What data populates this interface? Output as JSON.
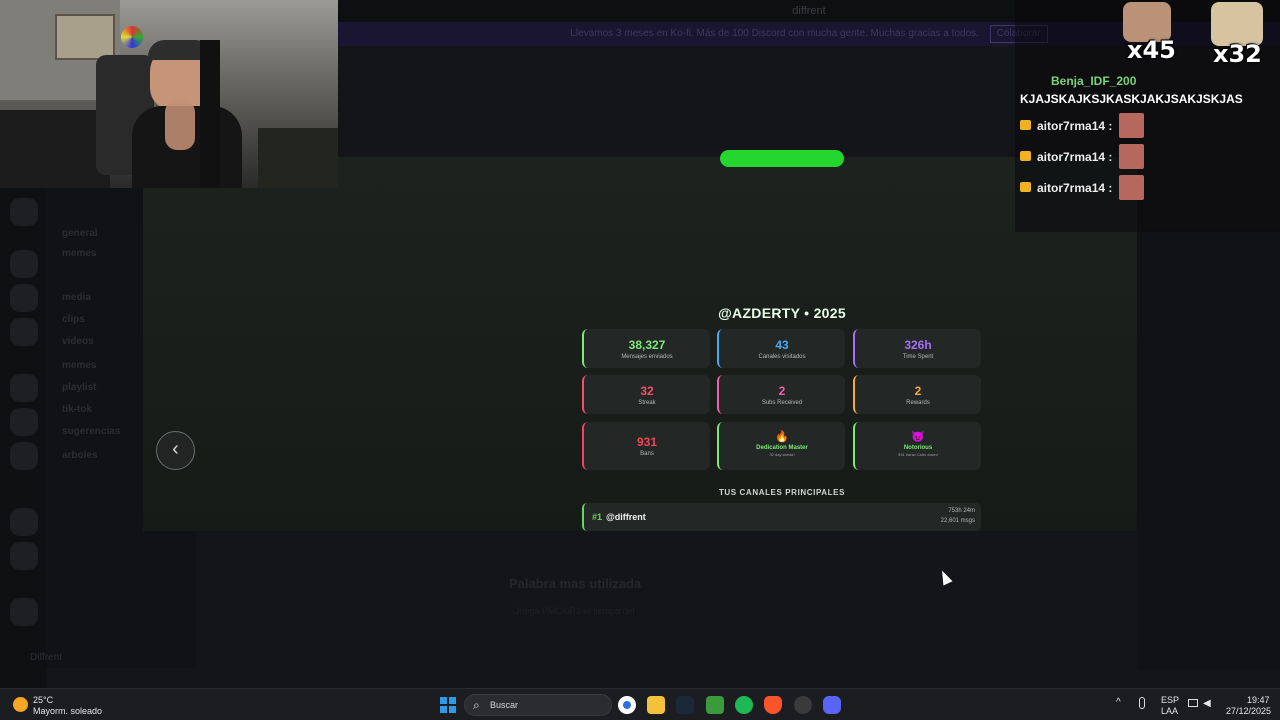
{
  "wrapped": {
    "title": "@AZDERTY • 2025",
    "back_symbol": "‹",
    "stats": [
      {
        "value": "38,327",
        "label": "Mensajes enviados",
        "color": "#7fe87a"
      },
      {
        "value": "43",
        "label": "Canales visitados",
        "color": "#4aa9f5"
      },
      {
        "value": "326h",
        "label": "Time Spent",
        "color": "#a86ef5"
      },
      {
        "value": "32",
        "label": "Streak",
        "color": "#f2506b"
      },
      {
        "value": "2",
        "label": "Subs Received",
        "color": "#ef5fb3"
      },
      {
        "value": "2",
        "label": "Rewards",
        "color": "#f5a742"
      },
      {
        "value": "931",
        "label": "Bans",
        "color": "#f0465a"
      }
    ],
    "badges": [
      {
        "emoji": "🔥",
        "name": "Dedication Master",
        "desc": "32 day streak!",
        "color": "#7fe87a"
      },
      {
        "emoji": "😈",
        "name": "Notorious",
        "desc": "931 bans! Calm down!",
        "color": "#7fe87a"
      }
    ],
    "channels_heading": "TUS CANALES PRINCIPALES",
    "top_channel": {
      "rank": "#1",
      "name": "@diffrent",
      "time": "753h 24m",
      "msgs": "22,601 msgs"
    }
  },
  "discord": {
    "window_title": "diffrent",
    "banner_text": "Llevamos 3 meses en Ko-fi. Más de 100 Discord con mucha gente. Muchas gracias a todos.",
    "banner_button": "Colaborar",
    "server_name": "Diffrent",
    "channels": [
      "general",
      "memes",
      "media",
      "clips",
      "videos",
      "memes",
      "playlist",
      "tik-tok",
      "sugerencias",
      "arboles"
    ],
    "bottom_heading": "Palabra mas utilizada",
    "bottom_sub": "Juega PMCI0R3 el tiempo del"
  },
  "chat": {
    "emote_counts": [
      "x45",
      "x32"
    ],
    "first_user": "Benja_IDF_200",
    "first_message": "KJAJSKAJKSJKASKJAKJSAKJSKJAS",
    "repeat_user": "aitor7rma14 :",
    "repeat_count": 3
  },
  "taskbar": {
    "temperature": "25°C",
    "weather": "Mayorm. soleado",
    "search": "Buscar",
    "lang": "ESP",
    "region": "LAA",
    "time": "19:47",
    "date": "27/12/2025"
  }
}
